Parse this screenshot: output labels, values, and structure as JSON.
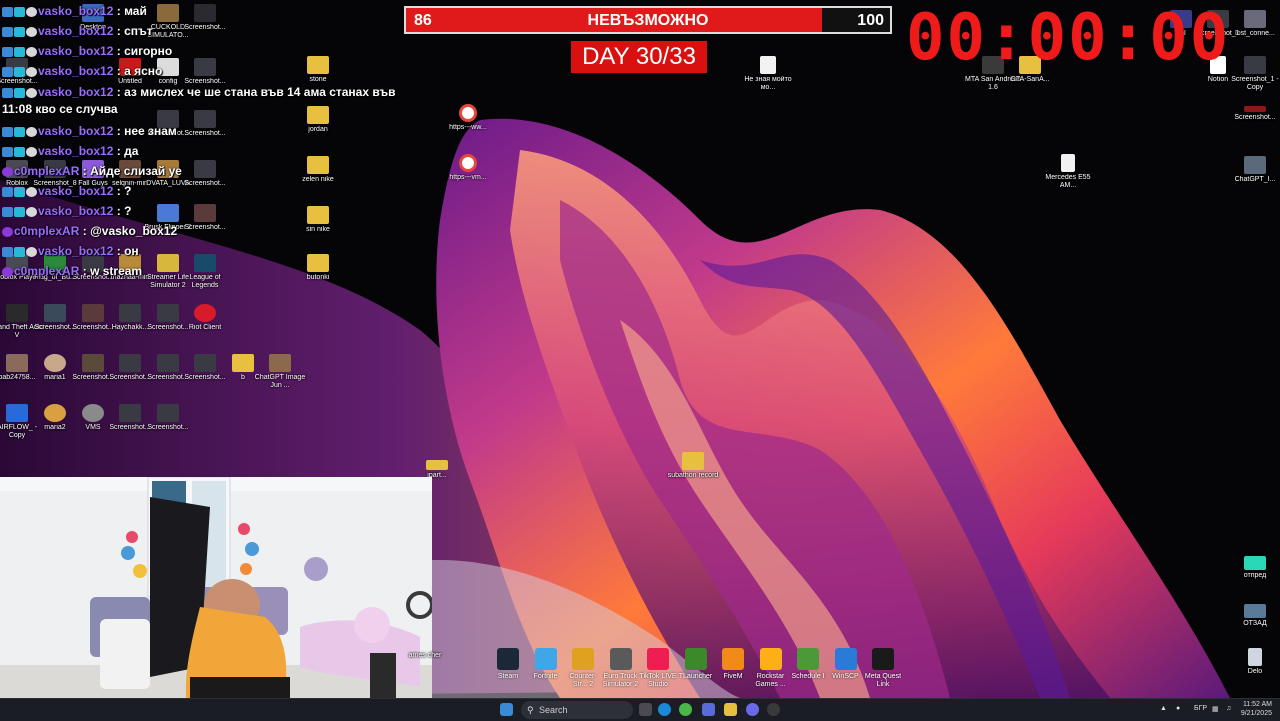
{
  "stream_overlay": {
    "progress_left": "86",
    "progress_title": "НЕВЪЗМОЖНО",
    "progress_right": "100",
    "progress_fraction": 0.86,
    "day_counter": "DAY 30/33",
    "timer": "00:00:00"
  },
  "chat": [
    {
      "user": "vasko_box12",
      "msg": "май"
    },
    {
      "user": "vasko_box12",
      "msg": "спът"
    },
    {
      "user": "vasko_box12",
      "msg": "сигорно"
    },
    {
      "user": "vasko_box12",
      "msg": "а ясно"
    },
    {
      "user": "vasko_box12",
      "msg": "аз мислех че ше стана във 14 ама станах във 11:08 кво се случва"
    },
    {
      "user": "vasko_box12",
      "msg": "нее знам"
    },
    {
      "user": "vasko_box12",
      "msg": "да"
    },
    {
      "user": "c0mplexAR",
      "msg": "Айде слизай уе"
    },
    {
      "user": "vasko_box12",
      "msg": "?"
    },
    {
      "user": "vasko_box12",
      "msg": "?"
    },
    {
      "user": "c0mplexAR",
      "msg": "@vasko_box12"
    },
    {
      "user": "vasko_box12",
      "msg": "он"
    },
    {
      "user": "c0mplexAR",
      "msg": "w stream"
    }
  ],
  "chat_sep": ":",
  "desktop_icons": {
    "left": [
      {
        "label": "Desktop"
      },
      {
        "label": "CUCKOLD SIMULATO..."
      },
      {
        "label": "Screenshot..."
      },
      {
        "label": "Screenshot..."
      },
      {
        "label": "Untitled"
      },
      {
        "label": "config"
      },
      {
        "label": "Screenshot..."
      },
      {
        "label": "Screenshot..."
      },
      {
        "label": "Screenshot..."
      },
      {
        "label": "Roblox"
      },
      {
        "label": "Screenshot_8"
      },
      {
        "label": "Fall Guys"
      },
      {
        "label": "selqnin-min"
      },
      {
        "label": "DVATA_LUVA"
      },
      {
        "label": "Screenshot..."
      },
      {
        "label": "Brusk Flipper 2"
      },
      {
        "label": "Screenshot..."
      },
      {
        "label": "Roblox Player"
      },
      {
        "label": "Flag_of_Bu..."
      },
      {
        "label": "Screenshot..."
      },
      {
        "label": "maznaa-min"
      },
      {
        "label": "Streamer Life Simulator 2"
      },
      {
        "label": "League of Legends"
      },
      {
        "label": "Grand Theft Auto V"
      },
      {
        "label": "Screenshot..."
      },
      {
        "label": "Screenshot..."
      },
      {
        "label": "Haychakk..."
      },
      {
        "label": "Screenshot..."
      },
      {
        "label": "Riot Client"
      },
      {
        "label": "bab24758..."
      },
      {
        "label": "maria1"
      },
      {
        "label": "Screenshot..."
      },
      {
        "label": "Screenshot..."
      },
      {
        "label": "Screenshot..."
      },
      {
        "label": "Screenshot..."
      },
      {
        "label": "b"
      },
      {
        "label": "ChatGPT Image Jun ..."
      },
      {
        "label": "AIRFLOW_ - Copy"
      },
      {
        "label": "maria2"
      },
      {
        "label": "VMS"
      },
      {
        "label": "Screenshot..."
      },
      {
        "label": "Screenshot..."
      }
    ],
    "folders": [
      {
        "label": "stone"
      },
      {
        "label": "jordan"
      },
      {
        "label": "zelen nike"
      },
      {
        "label": "sin nike"
      },
      {
        "label": "butonki"
      }
    ],
    "middle": [
      {
        "label": "https---ww..."
      },
      {
        "label": "https---vm..."
      },
      {
        "label": "Не зная мойто мо..."
      },
      {
        "label": "subathon record"
      },
      {
        "label": "ipart..."
      }
    ],
    "right": [
      {
        "label": "MTA San Andreas 1.6"
      },
      {
        "label": "GTA-SanA..."
      },
      {
        "label": "Mercedes E55 AM..."
      },
      {
        "label": "Notion"
      },
      {
        "label": "Screenshot_1 - Copy"
      },
      {
        "label": "Screenshot..."
      },
      {
        "label": "ChatGPT_I..."
      },
      {
        "label": "lost_conne..."
      },
      {
        "label": "Screenshot_1"
      },
      {
        "label": "nal"
      },
      {
        "label": "отпред"
      },
      {
        "label": "ОТЗАД"
      },
      {
        "label": "Delo"
      }
    ]
  },
  "dock": [
    {
      "label": "Steam",
      "color": "#1b2838"
    },
    {
      "label": "Fortnite",
      "color": "#3fa6e8"
    },
    {
      "label": "Counter-Str... 2",
      "color": "#e0a020"
    },
    {
      "label": "Euro Truck Simulator 2",
      "color": "#5a5a5a"
    },
    {
      "label": "TikTok LIVE Studio",
      "color": "#ee1d52"
    },
    {
      "label": "TLauncher",
      "color": "#3a8a2a"
    },
    {
      "label": "FiveM",
      "color": "#f28a1a"
    },
    {
      "label": "Rockstar Games ...",
      "color": "#fcaf17"
    },
    {
      "label": "Schedule I",
      "color": "#4a9a3a"
    },
    {
      "label": "WinSCP",
      "color": "#2a7ad8"
    },
    {
      "label": "Meta Quest Link",
      "color": "#1a1a1a"
    }
  ],
  "dock_partial": "ames cher",
  "taskbar": {
    "search_placeholder": "Search",
    "language": "БГР",
    "time": "11:52 AM",
    "date": "9/21/2025"
  }
}
